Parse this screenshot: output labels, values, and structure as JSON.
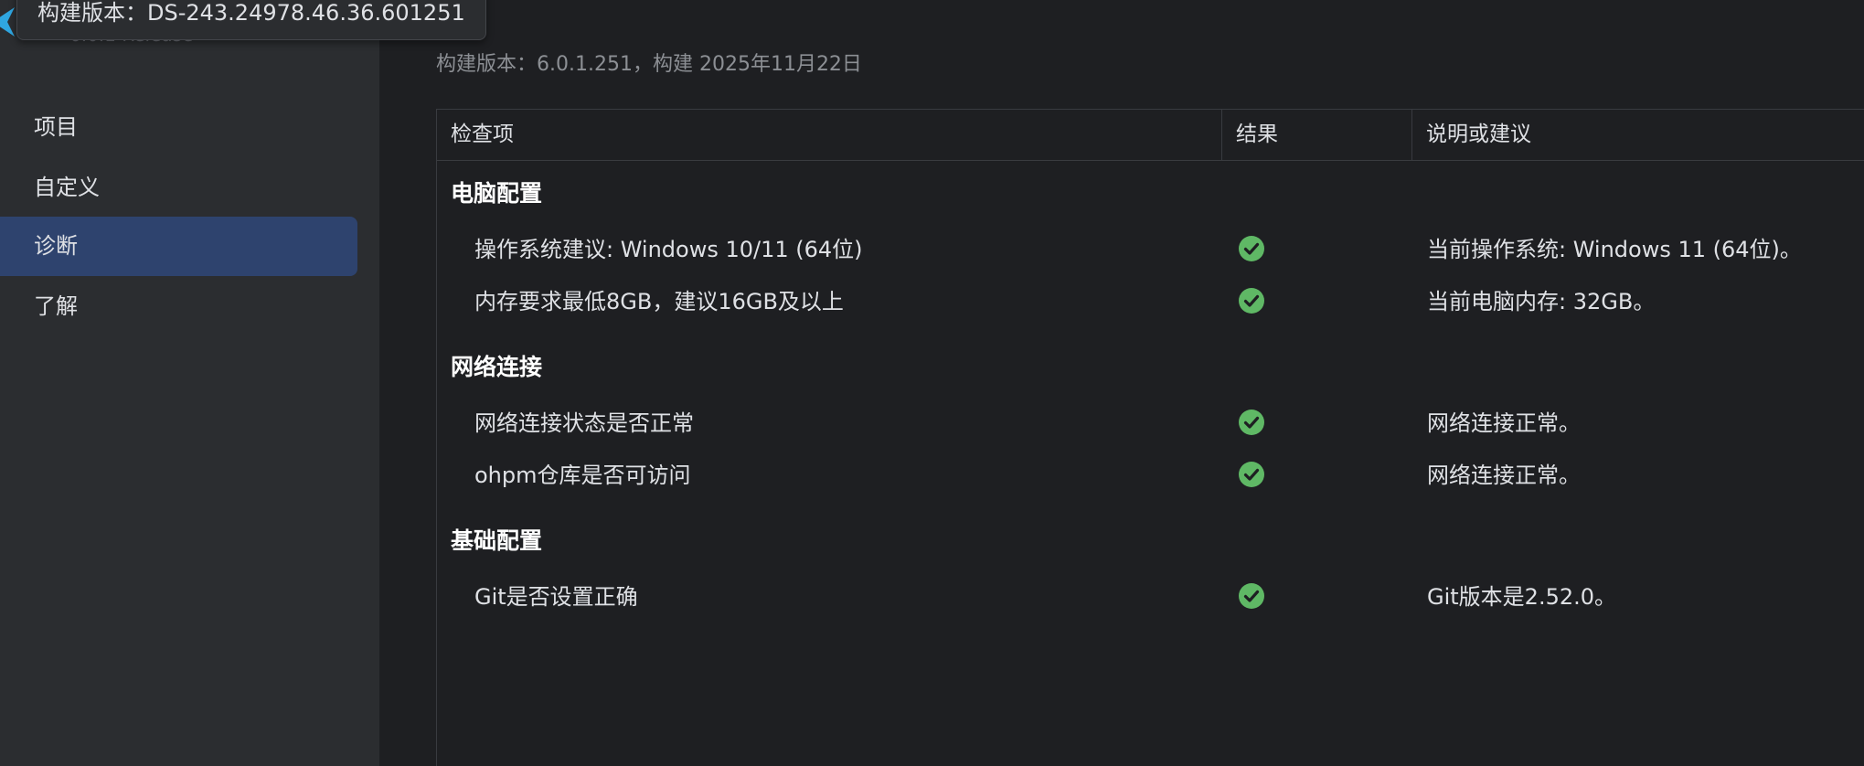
{
  "tooltip": {
    "text": "构建版本：DS-243.24978.46.36.601251"
  },
  "sidebar": {
    "release_label": "6.0.1 Release",
    "items": [
      {
        "label": "项目",
        "active": false
      },
      {
        "label": "自定义",
        "active": false
      },
      {
        "label": "诊断",
        "active": true
      },
      {
        "label": "了解",
        "active": false
      }
    ]
  },
  "main": {
    "build_info": "构建版本：6.0.1.251，构建 2025年11月22日",
    "table": {
      "headers": [
        "检查项",
        "结果",
        "说明或建议"
      ],
      "sections": [
        {
          "title": "电脑配置",
          "rows": [
            {
              "item": "操作系统建议: Windows 10/11 (64位)",
              "result": "pass",
              "note": "当前操作系统: Windows 11 (64位)。"
            },
            {
              "item": "内存要求最低8GB，建议16GB及以上",
              "result": "pass",
              "note": "当前电脑内存: 32GB。"
            }
          ]
        },
        {
          "title": "网络连接",
          "rows": [
            {
              "item": "网络连接状态是否正常",
              "result": "pass",
              "note": "网络连接正常。"
            },
            {
              "item": "ohpm仓库是否可访问",
              "result": "pass",
              "note": "网络连接正常。"
            }
          ]
        },
        {
          "title": "基础配置",
          "rows": [
            {
              "item": "Git是否设置正确",
              "result": "pass",
              "note": "Git版本是2.52.0。"
            }
          ]
        }
      ]
    }
  },
  "colors": {
    "background": "#1e1f22",
    "sidebar_bg": "#2b2d30",
    "active_item": "#2e436e",
    "success": "#5fb865"
  },
  "icons": {
    "logo": "deveco-logo-icon",
    "status_pass": "check-circle-icon"
  }
}
